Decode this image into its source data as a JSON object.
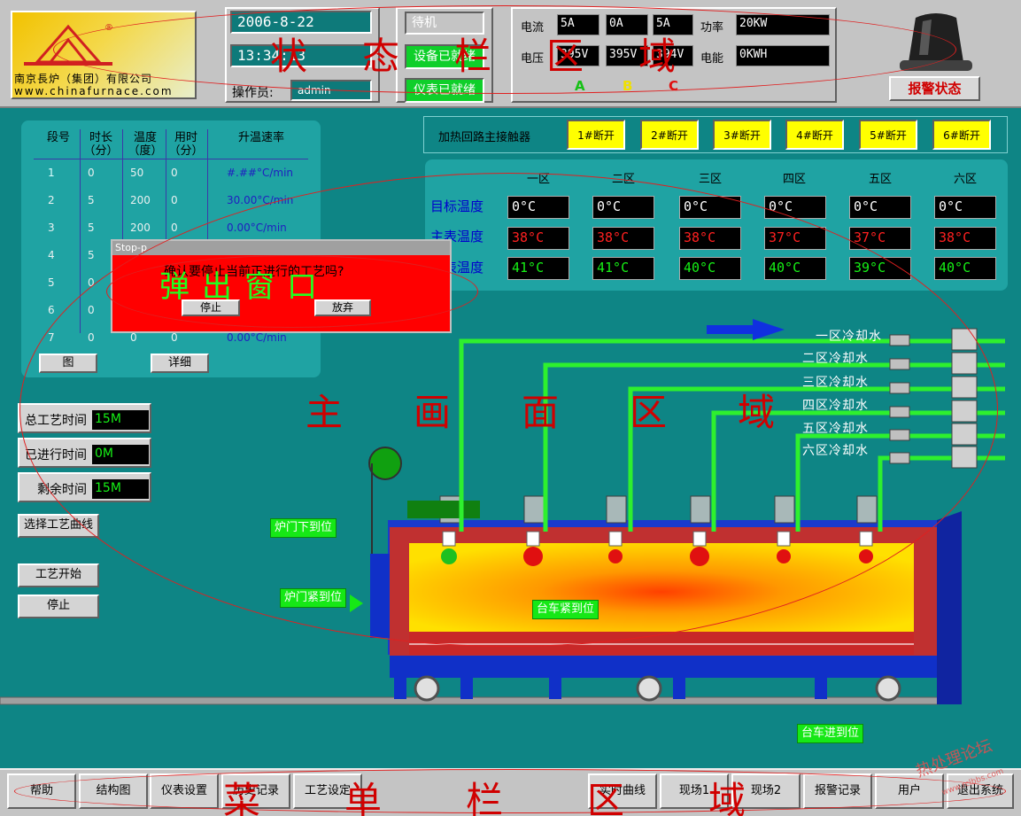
{
  "status_bar": {
    "company_name": "南京長炉（集团）有限公司",
    "company_url": "www.chinafurnace.com",
    "date": "2006-8-22",
    "time": "13:34:13",
    "operator_label": "操作员:",
    "operator_value": "admin",
    "state_standby": "待机",
    "state_equipment": "设备已就绪",
    "state_instrument": "仪表已就绪",
    "current_label": "电流",
    "current_values": [
      "5A",
      "0A",
      "5A"
    ],
    "voltage_label": "电压",
    "voltage_values": [
      "395V",
      "395V",
      "394V"
    ],
    "power_label": "功率",
    "power_value": "20KW",
    "energy_label": "电能",
    "energy_value": "0KWH",
    "phase_labels": [
      "A",
      "B",
      "C"
    ],
    "alarm_button": "报警状态"
  },
  "process_table": {
    "headers": [
      "段号",
      "时长（分）",
      "温度（度）",
      "用时（分）",
      "升温速率"
    ],
    "rows": [
      {
        "seg": "1",
        "dur": "0",
        "temp": "50",
        "used": "0",
        "rate": "#.##°C/min"
      },
      {
        "seg": "2",
        "dur": "5",
        "temp": "200",
        "used": "0",
        "rate": "30.00°C/min"
      },
      {
        "seg": "3",
        "dur": "5",
        "temp": "200",
        "used": "0",
        "rate": "0.00°C/min"
      },
      {
        "seg": "4",
        "dur": "5",
        "temp": "",
        "used": "",
        "rate": ""
      },
      {
        "seg": "5",
        "dur": "0",
        "temp": "",
        "used": "",
        "rate": ""
      },
      {
        "seg": "6",
        "dur": "0",
        "temp": "",
        "used": "",
        "rate": ""
      },
      {
        "seg": "7",
        "dur": "0",
        "temp": "0",
        "used": "0",
        "rate": "0.00°C/min"
      }
    ],
    "btn_chart": "图",
    "btn_detail": "详细"
  },
  "contactors": {
    "label": "加热回路主接触器",
    "buttons": [
      "1#断开",
      "2#断开",
      "3#断开",
      "4#断开",
      "5#断开",
      "6#断开"
    ]
  },
  "temperatures": {
    "zones": [
      "一区",
      "二区",
      "三区",
      "四区",
      "五区",
      "六区"
    ],
    "rows": [
      {
        "label": "目标温度",
        "color": "#ffffff",
        "values": [
          "0°C",
          "0°C",
          "0°C",
          "0°C",
          "0°C",
          "0°C"
        ]
      },
      {
        "label": "主表温度",
        "color": "#ff2020",
        "values": [
          "38°C",
          "38°C",
          "38°C",
          "37°C",
          "37°C",
          "38°C"
        ]
      },
      {
        "label": "监表温度",
        "color": "#16f016",
        "values": [
          "41°C",
          "41°C",
          "40°C",
          "40°C",
          "39°C",
          "40°C"
        ]
      }
    ]
  },
  "timers": {
    "total_label": "总工艺时间",
    "total_value": "15M",
    "elapsed_label": "已进行时间",
    "elapsed_value": "0M",
    "remaining_label": "剩余时间",
    "remaining_value": "15M"
  },
  "left_buttons": {
    "select_curve": "选择工艺曲线",
    "start": "工艺开始",
    "stop": "停止"
  },
  "cooling_water": [
    "一区冷却水",
    "二区冷却水",
    "三区冷却水",
    "四区冷却水",
    "五区冷却水",
    "六区冷却水"
  ],
  "furnace_tags": {
    "door_down": "炉门下到位",
    "door_clamp": "炉门紧到位",
    "car_clamp": "台车紧到位",
    "car_in": "台车进到位"
  },
  "popup": {
    "title": "Stop-p",
    "message": "确认要停止当前正进行的工艺吗?",
    "btn_stop": "停止",
    "btn_cancel": "放弃"
  },
  "menu": [
    "帮助",
    "结构图",
    "仪表设置",
    "历史记录",
    "工艺设定",
    "实时曲线",
    "现场1",
    "现场2",
    "报警记录",
    "用户",
    "退出系统"
  ],
  "annotations": {
    "status_area": "状态栏区域",
    "popup_area": "弹出窗口",
    "main_area": "主画面区域",
    "menu_area": "菜单栏区域"
  },
  "watermark": "热处理论坛",
  "watermark_url": "www.rclbbs.com"
}
